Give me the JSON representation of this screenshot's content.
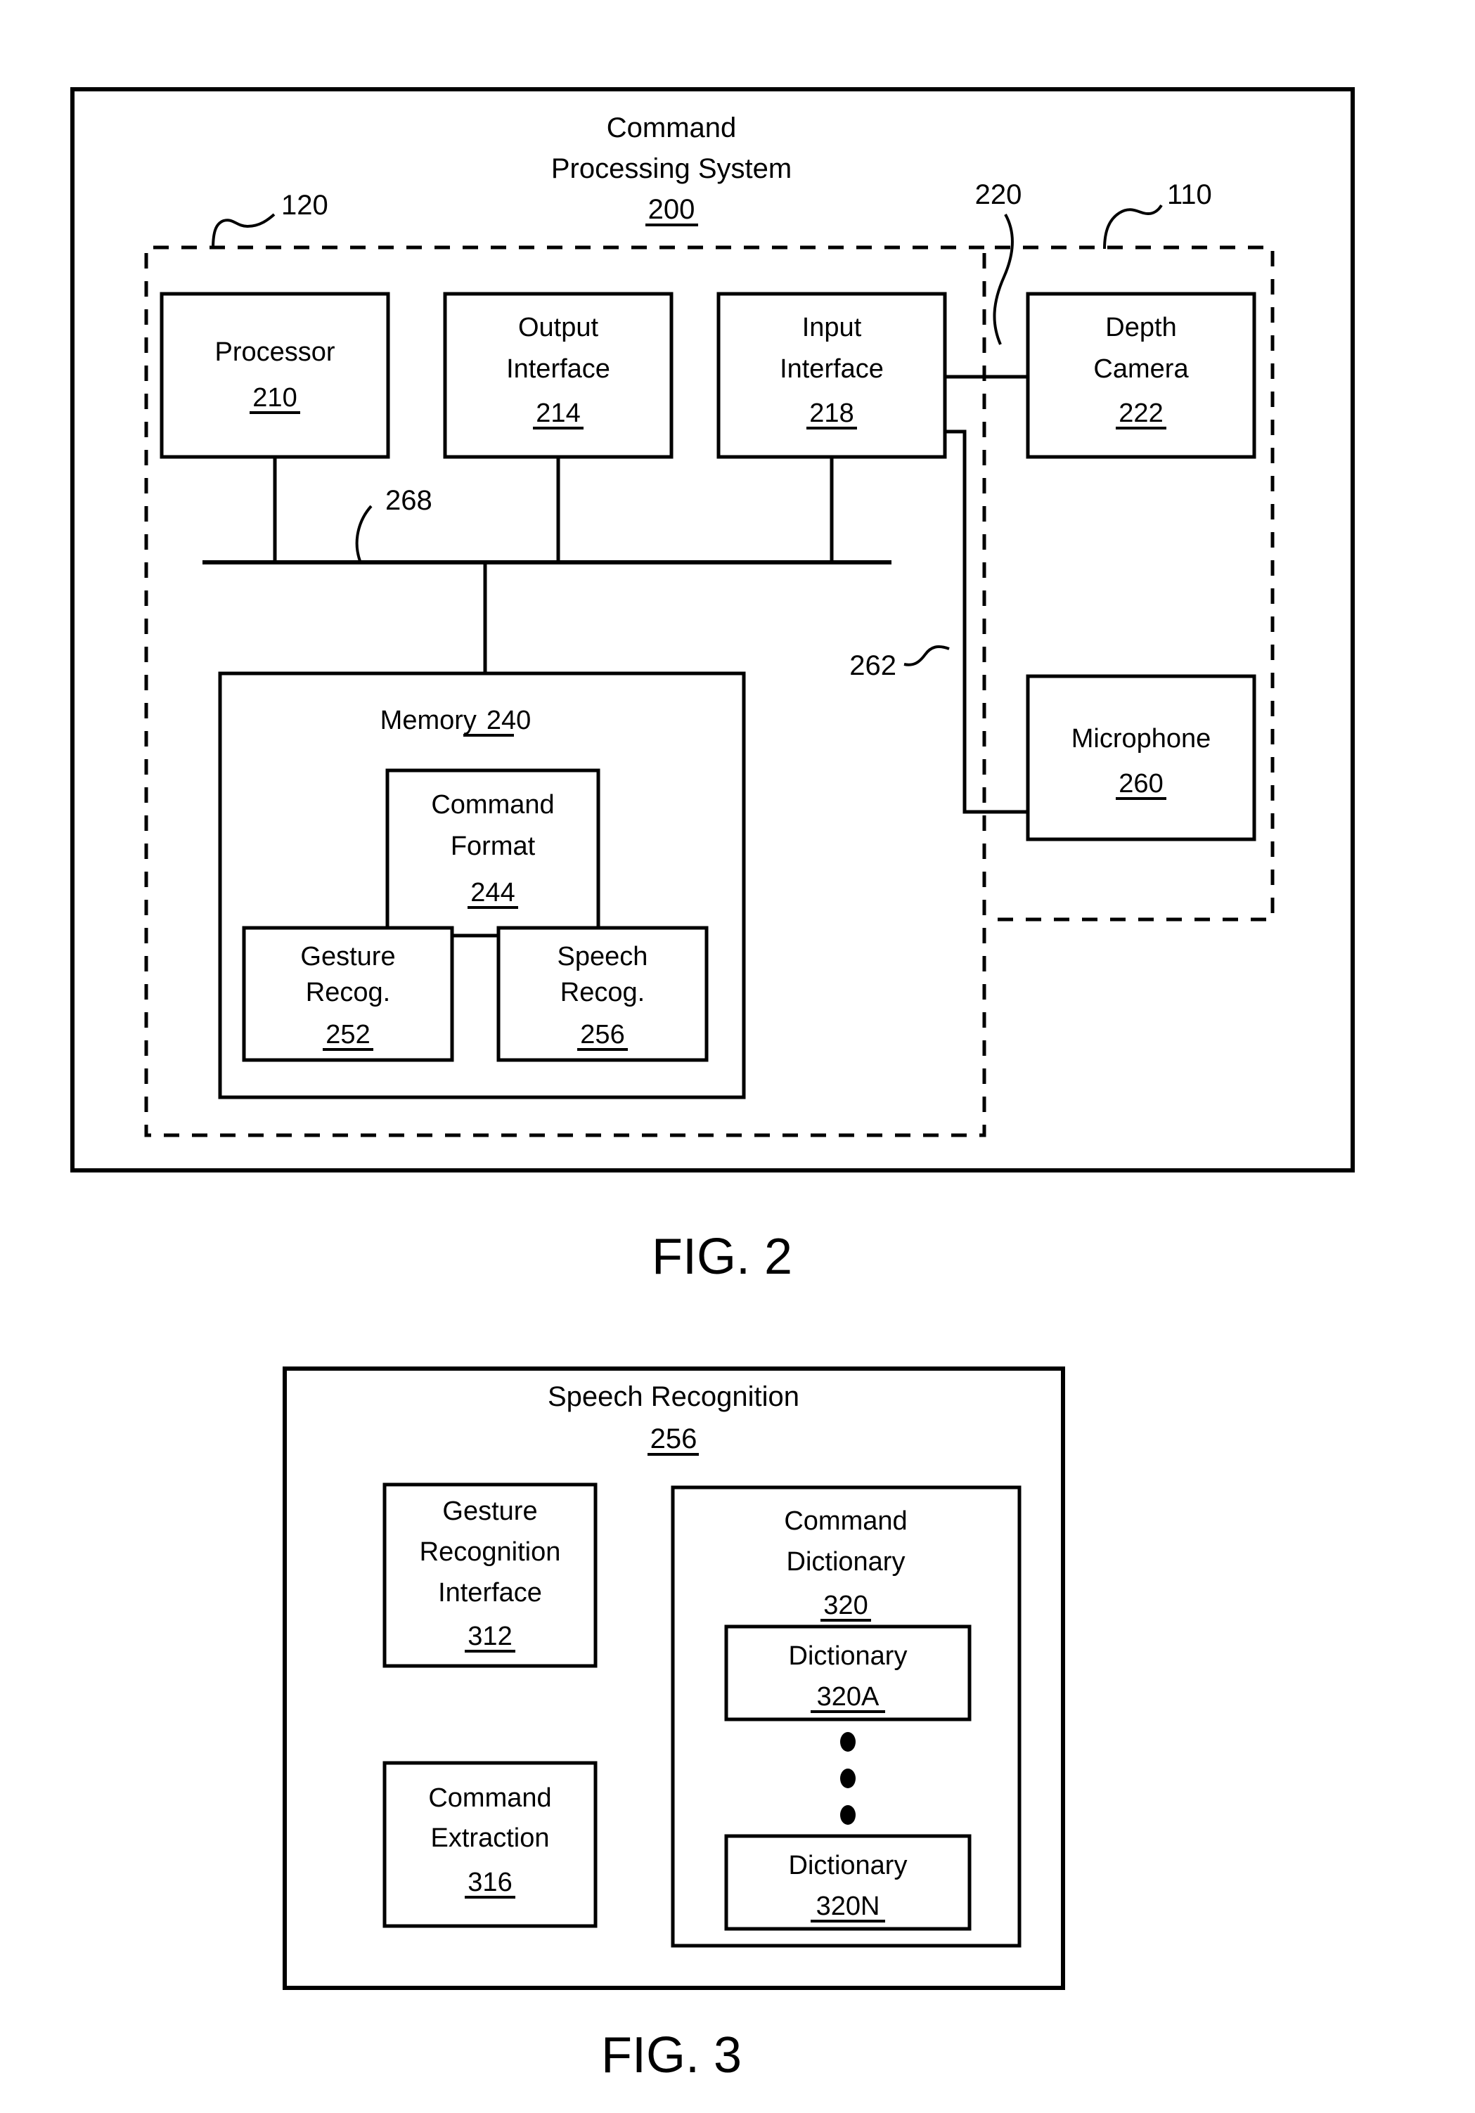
{
  "sheet": {
    "figures": [
      {
        "caption": "FIG. 2",
        "system_title_line1": "Command",
        "system_title_line2": "Processing System",
        "system_ref": "200",
        "boundary_refs": [
          {
            "id": "ref-120",
            "label": "120"
          },
          {
            "id": "ref-110",
            "label": "110"
          },
          {
            "id": "ref-220",
            "label": "220"
          },
          {
            "id": "ref-262",
            "label": "262"
          },
          {
            "id": "ref-268",
            "label": "268"
          }
        ],
        "blocks": [
          {
            "id": "processor",
            "lines": [
              "Processor"
            ],
            "ref": "210"
          },
          {
            "id": "output-interface",
            "lines": [
              "Output",
              "Interface"
            ],
            "ref": "214"
          },
          {
            "id": "input-interface",
            "lines": [
              "Input",
              "Interface"
            ],
            "ref": "218"
          },
          {
            "id": "depth-camera",
            "lines": [
              "Depth",
              "Camera"
            ],
            "ref": "222"
          },
          {
            "id": "microphone",
            "lines": [
              "Microphone"
            ],
            "ref": "260"
          },
          {
            "id": "memory",
            "lines": [
              "Memory"
            ],
            "ref": "240",
            "inline_ref": true
          },
          {
            "id": "command-format",
            "lines": [
              "Command",
              "Format"
            ],
            "ref": "244"
          },
          {
            "id": "gesture-recog",
            "lines": [
              "Gesture",
              "Recog."
            ],
            "ref": "252"
          },
          {
            "id": "speech-recog",
            "lines": [
              "Speech",
              "Recog."
            ],
            "ref": "256"
          }
        ]
      },
      {
        "caption": "FIG. 3",
        "system_title_line1": "Speech Recognition",
        "system_ref": "256",
        "blocks": [
          {
            "id": "gesture-recognition-interface",
            "lines": [
              "Gesture",
              "Recognition",
              "Interface"
            ],
            "ref": "312"
          },
          {
            "id": "command-extraction",
            "lines": [
              "Command",
              "Extraction"
            ],
            "ref": "316"
          },
          {
            "id": "command-dictionary",
            "lines": [
              "Command",
              "Dictionary"
            ],
            "ref": "320"
          },
          {
            "id": "dictionary-a",
            "lines": [
              "Dictionary"
            ],
            "ref": "320A"
          },
          {
            "id": "dictionary-n",
            "lines": [
              "Dictionary"
            ],
            "ref": "320N"
          }
        ],
        "ellipsis_dots": 3
      }
    ]
  },
  "fig2": {
    "title_l1": "Command",
    "title_l2": "Processing System",
    "title_ref": "200",
    "ref_120": "120",
    "ref_110": "110",
    "ref_220": "220",
    "ref_262": "262",
    "ref_268": "268",
    "processor_l1": "Processor",
    "processor_ref": "210",
    "output_l1": "Output",
    "output_l2": "Interface",
    "output_ref": "214",
    "input_l1": "Input",
    "input_l2": "Interface",
    "input_ref": "218",
    "depth_l1": "Depth",
    "depth_l2": "Camera",
    "depth_ref": "222",
    "mic_l1": "Microphone",
    "mic_ref": "260",
    "memory_l1": "Memory",
    "memory_ref": "240",
    "cmdfmt_l1": "Command",
    "cmdfmt_l2": "Format",
    "cmdfmt_ref": "244",
    "gest_l1": "Gesture",
    "gest_l2": "Recog.",
    "gest_ref": "252",
    "speech_l1": "Speech",
    "speech_l2": "Recog.",
    "speech_ref": "256",
    "caption": "FIG. 2"
  },
  "fig3": {
    "title_l1": "Speech Recognition",
    "title_ref": "256",
    "gri_l1": "Gesture",
    "gri_l2": "Recognition",
    "gri_l3": "Interface",
    "gri_ref": "312",
    "cmdext_l1": "Command",
    "cmdext_l2": "Extraction",
    "cmdext_ref": "316",
    "cmddict_l1": "Command",
    "cmddict_l2": "Dictionary",
    "cmddict_ref": "320",
    "dicta_l1": "Dictionary",
    "dicta_ref": "320A",
    "dictn_l1": "Dictionary",
    "dictn_ref": "320N",
    "caption": "FIG. 3"
  }
}
